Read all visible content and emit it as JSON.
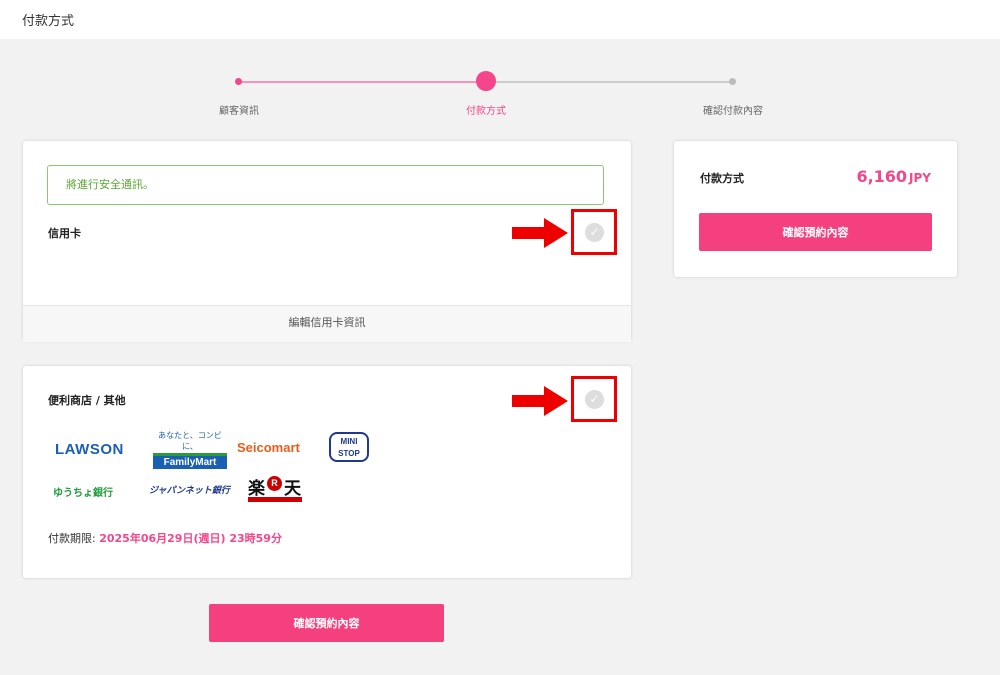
{
  "header": {
    "title": "付款方式"
  },
  "steps": [
    {
      "label": "顧客資訊"
    },
    {
      "label": "付款方式"
    },
    {
      "label": "確認付款內容"
    }
  ],
  "credit_card": {
    "notice": "將進行安全通訊。",
    "label": "信用卡",
    "edit_label": "編輯信用卡資訊"
  },
  "convenience": {
    "label": "便利商店 / 其他",
    "logos": {
      "lawson": "LAWSON",
      "familymart_top": "あなたと、コンビに、",
      "familymart": "FamilyMart",
      "seicomart": "Seicomart",
      "ministop_1": "MINI",
      "ministop_2": "STOP",
      "yucho": "ゆうちょ銀行",
      "japannet": "ジャパンネット銀行",
      "rakuten_1": "楽",
      "rakuten_r": "R",
      "rakuten_2": "天"
    },
    "deadline_label": "付款期限:",
    "deadline_value": "2025年06月29日(週日) 23時59分"
  },
  "summary": {
    "label": "付款方式",
    "amount": "6,160",
    "currency": "JPY",
    "confirm_label": "確認預約內容"
  },
  "bottom": {
    "confirm_label": "確認預約內容"
  },
  "colors": {
    "accent": "#f4407e",
    "success": "#5aa832",
    "highlight": "#e00000"
  }
}
